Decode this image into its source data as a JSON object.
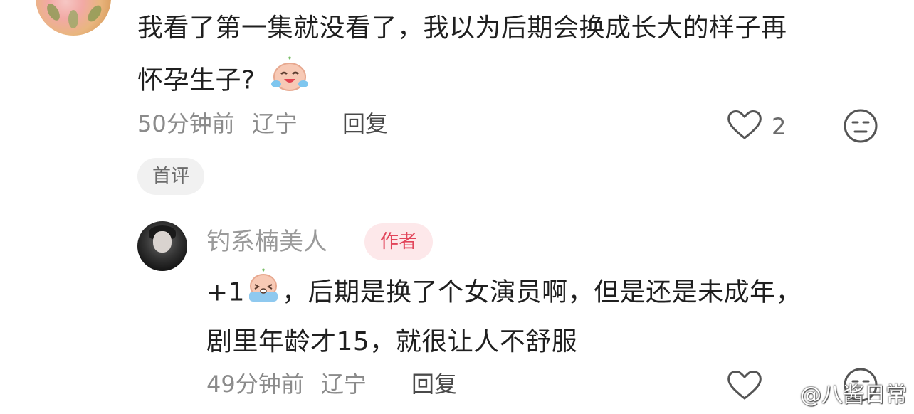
{
  "comments": [
    {
      "text_line1": "我看了第一集就没看了，我以为后期会换成长大的样子再",
      "text_line2": "怀孕生子?",
      "emoji": "crying-laughing-peach-emoji",
      "time": "50分钟前",
      "location": "辽宁",
      "reply_label": "回复",
      "like_count": "2",
      "first_badge": "首评"
    },
    {
      "username": "钓系楠美人",
      "author_badge": "作者",
      "text_prefix": "+1",
      "emoji": "crying-peach-emoji",
      "text_line1_rest": "，后期是换了个女演员啊，但是还是未成年，",
      "text_line2": "剧里年龄才15，就很让人不舒服",
      "time": "49分钟前",
      "location": "辽宁",
      "reply_label": "回复"
    }
  ],
  "watermark": "@八酱日常",
  "colors": {
    "text": "#1f1f1f",
    "meta": "#8b8b8b",
    "author_badge_bg": "#fde8ea",
    "author_badge_text": "#e2455a",
    "first_badge_bg": "#f1f1f1"
  },
  "icons": [
    "heart-outline-icon",
    "dislike-face-icon",
    "weibo-logo-icon"
  ]
}
